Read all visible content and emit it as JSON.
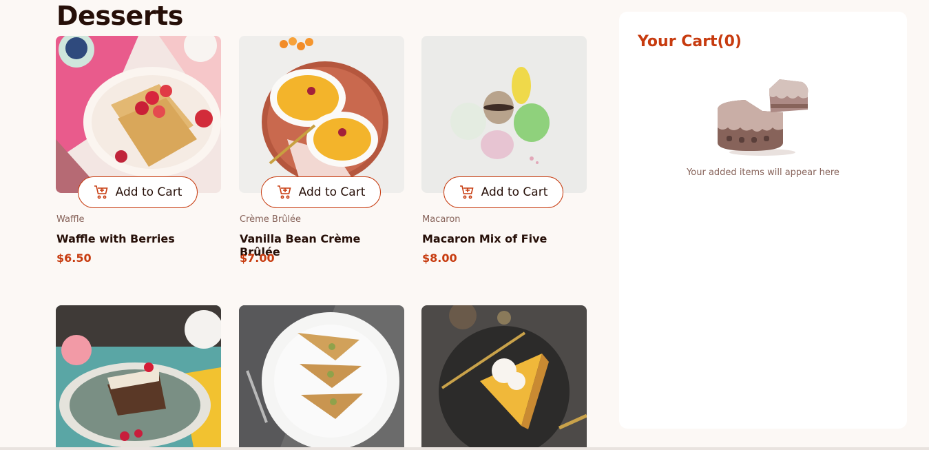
{
  "page": {
    "title": "Desserts"
  },
  "products": [
    {
      "category": "Waffle",
      "name": "Waffle with Berries",
      "price": "$6.50",
      "button_label": "Add to Cart"
    },
    {
      "category": "Crème Brûlée",
      "name": "Vanilla Bean Crème Brûlée",
      "price": "$7.00",
      "button_label": "Add to Cart"
    },
    {
      "category": "Macaron",
      "name": "Macaron Mix of Five",
      "price": "$8.00",
      "button_label": "Add to Cart"
    }
  ],
  "cart": {
    "title": "Your Cart(0)",
    "empty_message": "Your added items will appear here",
    "illustration": "empty-cart-cake-icon"
  },
  "icons": {
    "add_to_cart": "add-to-cart-icon"
  },
  "colors": {
    "accent": "#c73b0f",
    "text_dark": "#260f08",
    "text_muted": "#87635a",
    "background": "#fcf8f5",
    "panel": "#ffffff"
  }
}
